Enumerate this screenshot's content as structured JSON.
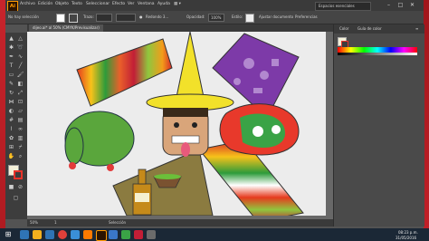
{
  "app": {
    "logo": "Ai",
    "menu": [
      "Archivo",
      "Edición",
      "Objeto",
      "Texto",
      "Seleccionar",
      "Efecto",
      "Ver",
      "Ventana",
      "Ayuda"
    ]
  },
  "search": {
    "label": "Espacios esenciales"
  },
  "window_controls": [
    "–",
    "□",
    "✕"
  ],
  "control_bar": {
    "selection": "No hay selección",
    "stroke_label": "Trazo:",
    "brush_label": "Redondo 3...",
    "opacity_label": "Opacidad:",
    "opacity_value": "100%",
    "style_label": "Estilo:",
    "doc_setup": "Ajustar documento",
    "prefs": "Preferencias"
  },
  "document_tab": {
    "title": "dijeo.ai* al 50% (CMYK/Previsualizar)"
  },
  "status_bar": {
    "zoom": "50%",
    "artboard": "1",
    "tool": "Selección"
  },
  "right_panel": {
    "tabs": [
      "Color",
      "Guía de color"
    ],
    "menu_icon": "≡"
  },
  "colors": {
    "accent_red": "#c2202a",
    "panel_dark": "#3d3d3d"
  },
  "taskbar": {
    "time": "08:23 p.m.",
    "date": "31/05/2016"
  }
}
